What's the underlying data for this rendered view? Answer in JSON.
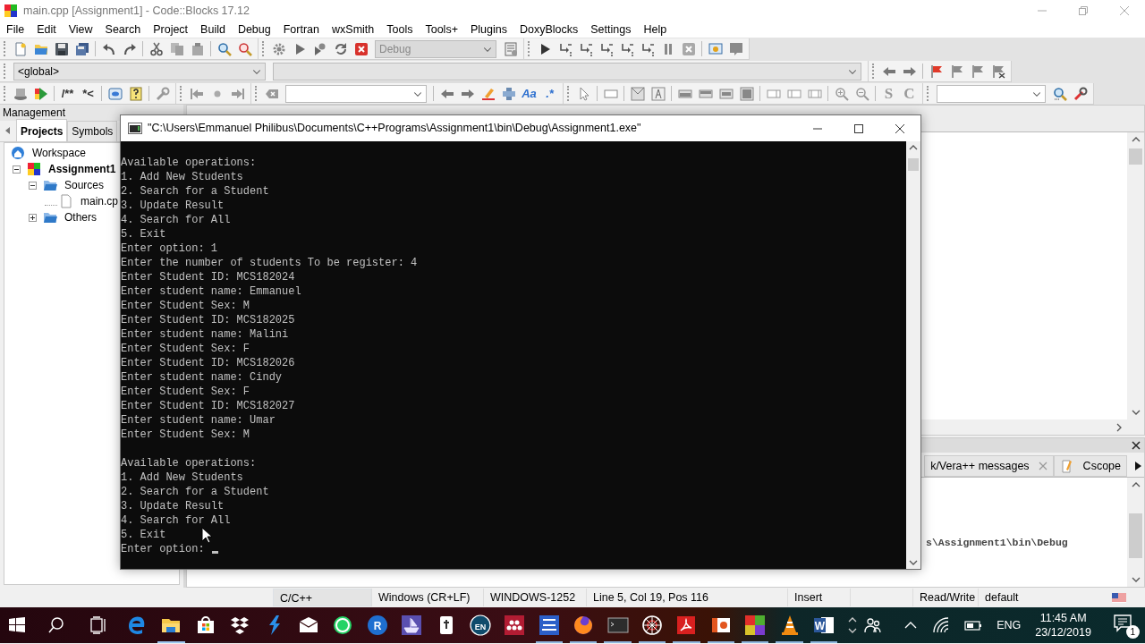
{
  "app": {
    "title": "main.cpp [Assignment1] - Code::Blocks 17.12"
  },
  "menu": [
    "File",
    "Edit",
    "View",
    "Search",
    "Project",
    "Build",
    "Debug",
    "Fortran",
    "wxSmith",
    "Tools",
    "Tools+",
    "Plugins",
    "DoxyBlocks",
    "Settings",
    "Help"
  ],
  "toolbar": {
    "build_target": {
      "value": "Debug",
      "disabled": true
    },
    "scope": {
      "value": "<global>"
    },
    "glyphs": [
      "/**",
      "*<",
      "Aa",
      ".*",
      "S",
      "C"
    ]
  },
  "management": {
    "title": "Management",
    "tabs": [
      {
        "label": "Projects",
        "selected": true
      },
      {
        "label": "Symbols",
        "selected": false
      }
    ],
    "tree": [
      {
        "label": "Workspace",
        "kind": "workspace",
        "children": [
          {
            "label": "Assignment1",
            "kind": "project",
            "expanded": true,
            "children": [
              {
                "label": "Sources",
                "kind": "folder",
                "expanded": true,
                "children": [
                  {
                    "label": "main.cp",
                    "kind": "file"
                  }
                ]
              },
              {
                "label": "Others",
                "kind": "folder",
                "expanded": false
              }
            ]
          }
        ]
      }
    ]
  },
  "logs": {
    "tabs": [
      {
        "label": "k/Vera++ messages",
        "closable": true
      },
      {
        "label": "Cscope",
        "closable": false
      }
    ],
    "lines": [
      "s\\Assignment1\\bin\\Debug"
    ]
  },
  "console": {
    "title": "\"C:\\Users\\Emmanuel Philibus\\Documents\\C++Programs\\Assignment1\\bin\\Debug\\Assignment1.exe\"",
    "cursor": true,
    "blocks": [
      [
        "Available operations:",
        "1. Add New Students",
        "2. Search for a Student",
        "3. Update Result",
        "4. Search for All",
        "5. Exit",
        "Enter option: 1",
        "Enter the number of students To be register: 4",
        "Enter Student ID: MCS182024",
        "Enter student name: Emmanuel",
        "Enter Student Sex: M",
        "Enter Student ID: MCS182025",
        "Enter student name: Malini",
        "Enter Student Sex: F",
        "Enter Student ID: MCS182026",
        "Enter student name: Cindy",
        "Enter Student Sex: F",
        "Enter Student ID: MCS182027",
        "Enter student name: Umar",
        "Enter Student Sex: M"
      ],
      [
        "Available operations:",
        "1. Add New Students",
        "2. Search for a Student",
        "3. Update Result",
        "4. Search for All",
        "5. Exit",
        "Enter option:"
      ]
    ]
  },
  "status_bar": [
    "C/C++",
    "Windows (CR+LF)",
    "WINDOWS-1252",
    "Line 5, Col 19, Pos 116",
    "Insert",
    "Read/Write",
    "default"
  ],
  "taskbar": {
    "apps": [
      {
        "running": false
      },
      {
        "running": true
      },
      {
        "running": false
      },
      {
        "running": false
      },
      {
        "running": false
      },
      {
        "running": false
      },
      {
        "running": false
      },
      {
        "running": false,
        "glyph": "R"
      },
      {
        "running": false
      },
      {
        "running": false
      },
      {
        "running": false,
        "glyph": "EN"
      },
      {
        "running": false
      },
      {
        "running": true
      },
      {
        "running": true
      },
      {
        "running": true
      },
      {
        "running": true
      },
      {
        "running": true
      },
      {
        "running": true
      },
      {
        "running": true
      },
      {
        "running": true
      },
      {
        "running": true,
        "glyph": "W"
      }
    ],
    "tray": {
      "language": "ENG",
      "time": "11:45 AM",
      "date": "23/12/2019",
      "notifications": "1"
    }
  }
}
